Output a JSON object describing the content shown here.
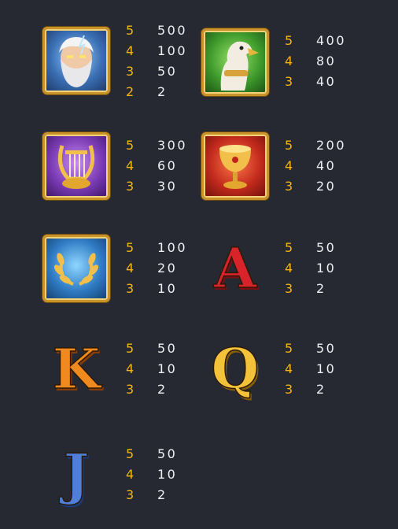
{
  "paytable": [
    {
      "symbol": "zeus-icon",
      "pays": [
        {
          "count": "5",
          "value": "500"
        },
        {
          "count": "4",
          "value": "100"
        },
        {
          "count": "3",
          "value": "50"
        },
        {
          "count": "2",
          "value": "2"
        }
      ]
    },
    {
      "symbol": "eagle-icon",
      "pays": [
        {
          "count": "5",
          "value": "400"
        },
        {
          "count": "4",
          "value": "80"
        },
        {
          "count": "3",
          "value": "40"
        }
      ]
    },
    {
      "symbol": "harp-icon",
      "pays": [
        {
          "count": "5",
          "value": "300"
        },
        {
          "count": "4",
          "value": "60"
        },
        {
          "count": "3",
          "value": "30"
        }
      ]
    },
    {
      "symbol": "chalice-icon",
      "pays": [
        {
          "count": "5",
          "value": "200"
        },
        {
          "count": "4",
          "value": "40"
        },
        {
          "count": "3",
          "value": "20"
        }
      ]
    },
    {
      "symbol": "laurel-wreath-icon",
      "pays": [
        {
          "count": "5",
          "value": "100"
        },
        {
          "count": "4",
          "value": "20"
        },
        {
          "count": "3",
          "value": "10"
        }
      ]
    },
    {
      "symbol": "letter-a-icon",
      "pays": [
        {
          "count": "5",
          "value": "50"
        },
        {
          "count": "4",
          "value": "10"
        },
        {
          "count": "3",
          "value": "2"
        }
      ]
    },
    {
      "symbol": "letter-k-icon",
      "pays": [
        {
          "count": "5",
          "value": "50"
        },
        {
          "count": "4",
          "value": "10"
        },
        {
          "count": "3",
          "value": "2"
        }
      ]
    },
    {
      "symbol": "letter-q-icon",
      "pays": [
        {
          "count": "5",
          "value": "50"
        },
        {
          "count": "4",
          "value": "10"
        },
        {
          "count": "3",
          "value": "2"
        }
      ]
    },
    {
      "symbol": "letter-j-icon",
      "pays": [
        {
          "count": "5",
          "value": "50"
        },
        {
          "count": "4",
          "value": "10"
        },
        {
          "count": "3",
          "value": "2"
        }
      ]
    }
  ],
  "symbol_letters": {
    "a": "A",
    "k": "K",
    "q": "Q",
    "j": "J"
  },
  "colors": {
    "background": "#262932",
    "count": "#f5b40e",
    "value": "#eef0f3",
    "frame": "#c9932a"
  }
}
